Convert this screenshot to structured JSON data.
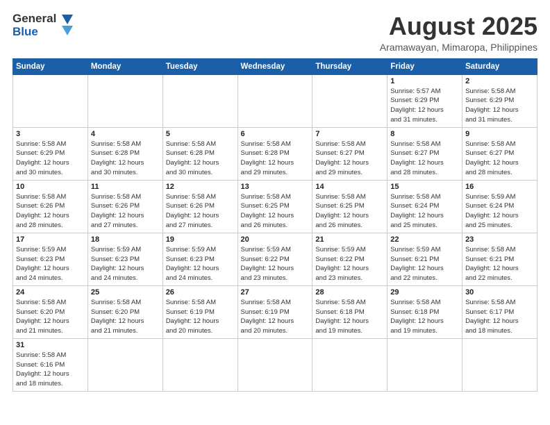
{
  "header": {
    "logo_general": "General",
    "logo_blue": "Blue",
    "month_year": "August 2025",
    "location": "Aramawayan, Mimaropa, Philippines"
  },
  "weekdays": [
    "Sunday",
    "Monday",
    "Tuesday",
    "Wednesday",
    "Thursday",
    "Friday",
    "Saturday"
  ],
  "weeks": [
    [
      {
        "date": "",
        "info": ""
      },
      {
        "date": "",
        "info": ""
      },
      {
        "date": "",
        "info": ""
      },
      {
        "date": "",
        "info": ""
      },
      {
        "date": "",
        "info": ""
      },
      {
        "date": "1",
        "info": "Sunrise: 5:57 AM\nSunset: 6:29 PM\nDaylight: 12 hours\nand 31 minutes."
      },
      {
        "date": "2",
        "info": "Sunrise: 5:58 AM\nSunset: 6:29 PM\nDaylight: 12 hours\nand 31 minutes."
      }
    ],
    [
      {
        "date": "3",
        "info": "Sunrise: 5:58 AM\nSunset: 6:29 PM\nDaylight: 12 hours\nand 30 minutes."
      },
      {
        "date": "4",
        "info": "Sunrise: 5:58 AM\nSunset: 6:28 PM\nDaylight: 12 hours\nand 30 minutes."
      },
      {
        "date": "5",
        "info": "Sunrise: 5:58 AM\nSunset: 6:28 PM\nDaylight: 12 hours\nand 30 minutes."
      },
      {
        "date": "6",
        "info": "Sunrise: 5:58 AM\nSunset: 6:28 PM\nDaylight: 12 hours\nand 29 minutes."
      },
      {
        "date": "7",
        "info": "Sunrise: 5:58 AM\nSunset: 6:27 PM\nDaylight: 12 hours\nand 29 minutes."
      },
      {
        "date": "8",
        "info": "Sunrise: 5:58 AM\nSunset: 6:27 PM\nDaylight: 12 hours\nand 28 minutes."
      },
      {
        "date": "9",
        "info": "Sunrise: 5:58 AM\nSunset: 6:27 PM\nDaylight: 12 hours\nand 28 minutes."
      }
    ],
    [
      {
        "date": "10",
        "info": "Sunrise: 5:58 AM\nSunset: 6:26 PM\nDaylight: 12 hours\nand 28 minutes."
      },
      {
        "date": "11",
        "info": "Sunrise: 5:58 AM\nSunset: 6:26 PM\nDaylight: 12 hours\nand 27 minutes."
      },
      {
        "date": "12",
        "info": "Sunrise: 5:58 AM\nSunset: 6:26 PM\nDaylight: 12 hours\nand 27 minutes."
      },
      {
        "date": "13",
        "info": "Sunrise: 5:58 AM\nSunset: 6:25 PM\nDaylight: 12 hours\nand 26 minutes."
      },
      {
        "date": "14",
        "info": "Sunrise: 5:58 AM\nSunset: 6:25 PM\nDaylight: 12 hours\nand 26 minutes."
      },
      {
        "date": "15",
        "info": "Sunrise: 5:58 AM\nSunset: 6:24 PM\nDaylight: 12 hours\nand 25 minutes."
      },
      {
        "date": "16",
        "info": "Sunrise: 5:59 AM\nSunset: 6:24 PM\nDaylight: 12 hours\nand 25 minutes."
      }
    ],
    [
      {
        "date": "17",
        "info": "Sunrise: 5:59 AM\nSunset: 6:23 PM\nDaylight: 12 hours\nand 24 minutes."
      },
      {
        "date": "18",
        "info": "Sunrise: 5:59 AM\nSunset: 6:23 PM\nDaylight: 12 hours\nand 24 minutes."
      },
      {
        "date": "19",
        "info": "Sunrise: 5:59 AM\nSunset: 6:23 PM\nDaylight: 12 hours\nand 24 minutes."
      },
      {
        "date": "20",
        "info": "Sunrise: 5:59 AM\nSunset: 6:22 PM\nDaylight: 12 hours\nand 23 minutes."
      },
      {
        "date": "21",
        "info": "Sunrise: 5:59 AM\nSunset: 6:22 PM\nDaylight: 12 hours\nand 23 minutes."
      },
      {
        "date": "22",
        "info": "Sunrise: 5:59 AM\nSunset: 6:21 PM\nDaylight: 12 hours\nand 22 minutes."
      },
      {
        "date": "23",
        "info": "Sunrise: 5:58 AM\nSunset: 6:21 PM\nDaylight: 12 hours\nand 22 minutes."
      }
    ],
    [
      {
        "date": "24",
        "info": "Sunrise: 5:58 AM\nSunset: 6:20 PM\nDaylight: 12 hours\nand 21 minutes."
      },
      {
        "date": "25",
        "info": "Sunrise: 5:58 AM\nSunset: 6:20 PM\nDaylight: 12 hours\nand 21 minutes."
      },
      {
        "date": "26",
        "info": "Sunrise: 5:58 AM\nSunset: 6:19 PM\nDaylight: 12 hours\nand 20 minutes."
      },
      {
        "date": "27",
        "info": "Sunrise: 5:58 AM\nSunset: 6:19 PM\nDaylight: 12 hours\nand 20 minutes."
      },
      {
        "date": "28",
        "info": "Sunrise: 5:58 AM\nSunset: 6:18 PM\nDaylight: 12 hours\nand 19 minutes."
      },
      {
        "date": "29",
        "info": "Sunrise: 5:58 AM\nSunset: 6:18 PM\nDaylight: 12 hours\nand 19 minutes."
      },
      {
        "date": "30",
        "info": "Sunrise: 5:58 AM\nSunset: 6:17 PM\nDaylight: 12 hours\nand 18 minutes."
      }
    ],
    [
      {
        "date": "31",
        "info": "Sunrise: 5:58 AM\nSunset: 6:16 PM\nDaylight: 12 hours\nand 18 minutes."
      },
      {
        "date": "",
        "info": ""
      },
      {
        "date": "",
        "info": ""
      },
      {
        "date": "",
        "info": ""
      },
      {
        "date": "",
        "info": ""
      },
      {
        "date": "",
        "info": ""
      },
      {
        "date": "",
        "info": ""
      }
    ]
  ]
}
